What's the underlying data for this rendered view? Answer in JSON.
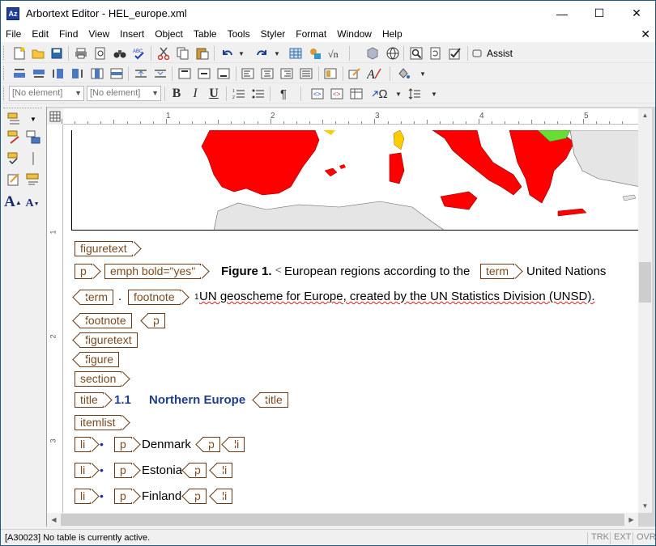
{
  "window": {
    "title": "Arbortext Editor - HEL_europe.xml",
    "app_icon": "Az",
    "controls": {
      "minimize": "—",
      "maximize": "☐",
      "close": "✕"
    }
  },
  "menu": [
    "File",
    "Edit",
    "Find",
    "View",
    "Insert",
    "Object",
    "Table",
    "Tools",
    "Styler",
    "Format",
    "Window",
    "Help"
  ],
  "menu_close": "✕",
  "toolbar": {
    "assist_label": "Assist",
    "element_combo_1": "[No element]",
    "element_combo_2": "[No element]",
    "bold": "B",
    "italic": "I",
    "underline": "U",
    "pilcrow": "¶",
    "omega": "Ω"
  },
  "ruler": {
    "numbers": [
      "1",
      "2",
      "3",
      "4",
      "5"
    ],
    "vertical_numbers": [
      "1",
      "2",
      "3"
    ]
  },
  "document": {
    "tags": {
      "figuretext_open": "figuretext",
      "p_open": "p",
      "emph_open": "emph bold=\"yes\"",
      "term_open": "term",
      "term_close": "term",
      "footnote_open": "footnote",
      "footnote_close": "footnote",
      "p_close": "p",
      "figuretext_close": "figuretext",
      "figure_close": "figure",
      "section_open": "section",
      "title_open": "title",
      "title_close": "title",
      "itemlist_open": "itemlist",
      "li": "li",
      "p": "p"
    },
    "figure_label": "Figure 1.",
    "caption_1": "European regions according to the",
    "term_text": "United Nations",
    "period": ".",
    "footnote_marker": "1",
    "footnote_text": "UN geoscheme for Europe, created by the UN Statistics Division (UNSD).",
    "section_number": "1.1",
    "section_title": "Northern Europe",
    "list_items": [
      "Denmark",
      "Estonia",
      "Finland"
    ],
    "bullet": "•"
  },
  "status": {
    "message": "[A30023] No table is currently active.",
    "fields": [
      "TRK",
      "EXT",
      "OVR"
    ]
  },
  "colors": {
    "tag_border": "#6b3a16",
    "title_blue": "#1f3fa8",
    "map_red": "#ff0000",
    "map_green": "#66dd33",
    "map_grey": "#e5e5e5"
  }
}
